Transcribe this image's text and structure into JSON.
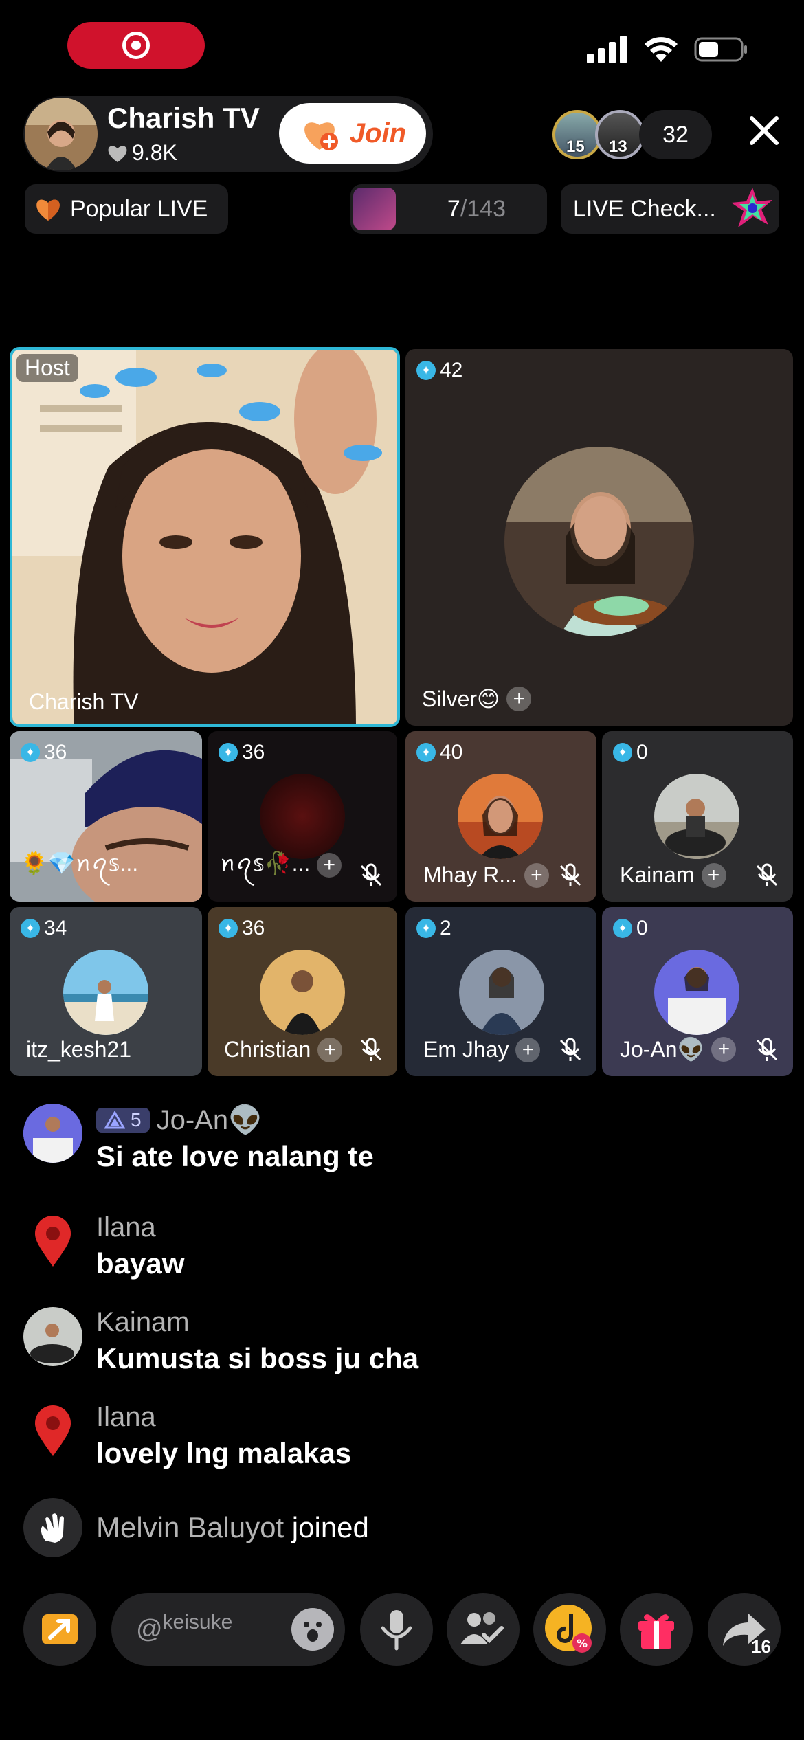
{
  "status_bar": {
    "signal_icon": "signal-bars-icon",
    "wifi_icon": "wifi-icon",
    "battery_icon": "battery-icon"
  },
  "host": {
    "name": "Charish TV",
    "likes": "9.8K",
    "join_label": "Join"
  },
  "viewers": {
    "top_badges": [
      "15",
      "13"
    ],
    "count": "32"
  },
  "chips": {
    "popular": "Popular LIVE",
    "rank_current": "7",
    "rank_total": "/143",
    "check": "LIVE Check..."
  },
  "grid": {
    "host_tile": {
      "tag": "Host",
      "name": "Charish TV"
    },
    "tiles": [
      {
        "name": "Silver😊",
        "score": "42"
      },
      {
        "name": "🌻💎ꪀꪖ𝕤...",
        "score": "36"
      },
      {
        "name": "ꪀꪖ𝕤🥀...",
        "score": "36"
      },
      {
        "name": "Mhay R...",
        "score": "40"
      },
      {
        "name": "Kainam",
        "score": "0"
      },
      {
        "name": "itz_kesh21",
        "score": "34"
      },
      {
        "name": "Christian",
        "score": "36"
      },
      {
        "name": "Em Jhay",
        "score": "2"
      },
      {
        "name": "Jo-An👽",
        "score": "0"
      }
    ]
  },
  "chat": [
    {
      "user": "Jo-An👽",
      "level": "5",
      "message": "Si ate love nalang te"
    },
    {
      "user": "Ilana",
      "message": "bayaw"
    },
    {
      "user": "Kainam",
      "message": "Kumusta si boss ju cha"
    },
    {
      "user": "Ilana",
      "message": "lovely lng malakas"
    },
    {
      "user": "Melvin Baluyot",
      "message": "joined"
    }
  ],
  "bottom_bar": {
    "input_prefix": "@",
    "input_placeholder": "keisuke",
    "share_count": "16"
  },
  "colors": {
    "accent": "#f05a28",
    "host_border": "#2fb8d6",
    "record": "#d0122c",
    "diamond": "#39b7e6"
  }
}
